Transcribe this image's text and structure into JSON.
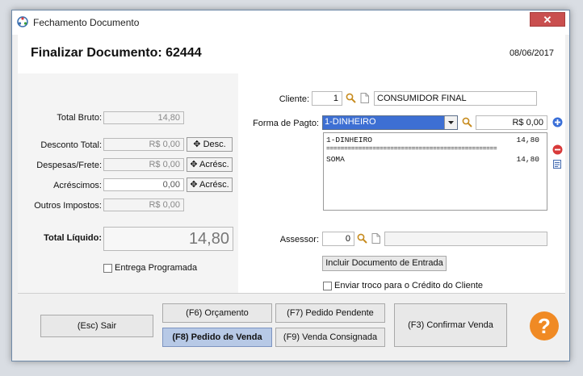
{
  "window": {
    "title": "Fechamento Documento",
    "close_glyph": "✕"
  },
  "header": {
    "title": "Finalizar Documento: 62444",
    "date": "08/06/2017"
  },
  "totals": {
    "bruto_label": "Total Bruto:",
    "bruto_value": "14,80",
    "desconto_label": "Desconto Total:",
    "desconto_value": "R$ 0,00",
    "desconto_btn": "Desc.",
    "despesas_label": "Despesas/Frete:",
    "despesas_value": "R$ 0,00",
    "despesas_btn": "Acrésc.",
    "acrescimos_label": "Acréscimos:",
    "acrescimos_value": "0,00",
    "acrescimos_btn": "Acrésc.",
    "impostos_label": "Outros Impostos:",
    "impostos_value": "R$ 0,00",
    "liquido_label": "Total Líquido:",
    "liquido_value": "14,80",
    "entrega_label": "Entrega Programada"
  },
  "client": {
    "label": "Cliente:",
    "code": "1",
    "name": "CONSUMIDOR FINAL"
  },
  "payment": {
    "label": "Forma de Pagto:",
    "selected": "1-DINHEIRO",
    "amount": "R$ 0,00",
    "list": [
      {
        "name": "1-DINHEIRO",
        "value": "14,80"
      },
      {
        "name": "================================================",
        "value": ""
      },
      {
        "name": "SOMA",
        "value": "14,80"
      }
    ]
  },
  "assessor": {
    "label": "Assessor:",
    "code": "0",
    "name": ""
  },
  "actions": {
    "incluir_doc": "Incluir Documento de Entrada",
    "troco_label": "Enviar troco para o Crédito do Cliente"
  },
  "footer": {
    "sair": "(Esc) Sair",
    "orcamento": "(F6) Orçamento",
    "pedido_pendente": "(F7) Pedido Pendente",
    "pedido_venda": "(F8) Pedido de Venda",
    "venda_consignada": "(F9) Venda Consignada",
    "confirmar": "(F3) Confirmar Venda",
    "help": "?"
  },
  "colors": {
    "accent_blue": "#b7c9e6",
    "help_orange": "#f08a24",
    "add_blue": "#3a6fd8",
    "remove_red": "#d83a3a"
  }
}
